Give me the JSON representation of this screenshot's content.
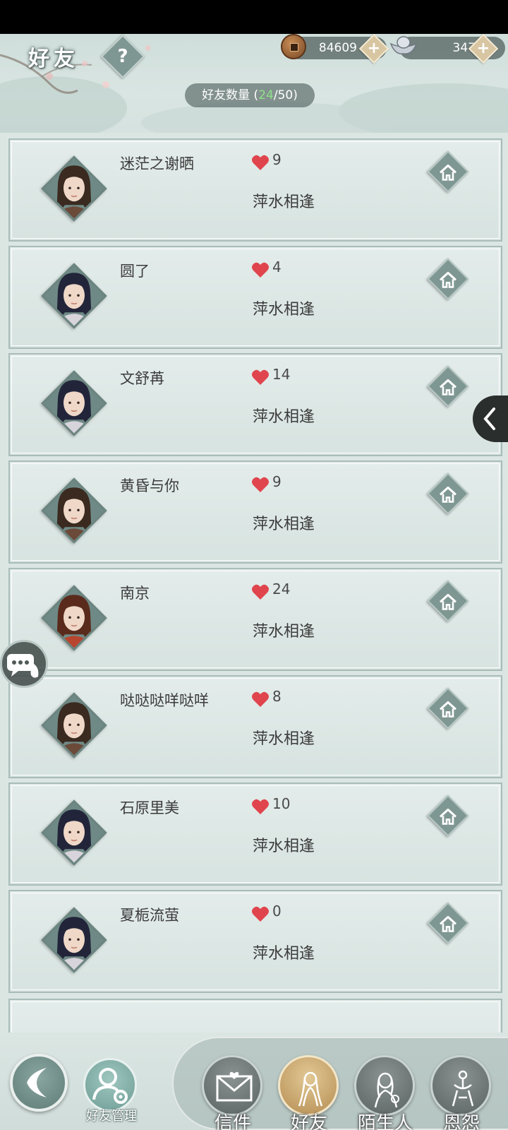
{
  "header": {
    "title": "好友",
    "help_label": "?",
    "copper": "84609",
    "silver": "347",
    "plus_label": "+",
    "friend_count_prefix": "好友数量 (",
    "friend_count_current": "24",
    "friend_count_suffix": "/50)"
  },
  "friends": [
    {
      "name": "迷茫之谢晒",
      "likes": "9",
      "relation": "萍水相逢",
      "hair": "#3a2a20",
      "robe": "#6b4a3a"
    },
    {
      "name": "圆了",
      "likes": "4",
      "relation": "萍水相逢",
      "hair": "#22253a",
      "robe": "#d8d4dc"
    },
    {
      "name": "文舒苒",
      "likes": "14",
      "relation": "萍水相逢",
      "hair": "#22253a",
      "robe": "#d8d4dc"
    },
    {
      "name": "黄昏与你",
      "likes": "9",
      "relation": "萍水相逢",
      "hair": "#3a2a20",
      "robe": "#6b4a3a"
    },
    {
      "name": "南京",
      "likes": "24",
      "relation": "萍水相逢",
      "hair": "#5a2b1c",
      "robe": "#b8452f"
    },
    {
      "name": "哒哒哒咩哒咩",
      "likes": "8",
      "relation": "萍水相逢",
      "hair": "#3a2a20",
      "robe": "#6b4a3a"
    },
    {
      "name": "石原里美",
      "likes": "10",
      "relation": "萍水相逢",
      "hair": "#22253a",
      "robe": "#d8d4dc"
    },
    {
      "name": "夏栀流萤",
      "likes": "0",
      "relation": "萍水相逢",
      "hair": "#22253a",
      "robe": "#d8d4dc"
    }
  ],
  "bottom": {
    "manage_label": "好友管理",
    "tabs": [
      {
        "label": "信件",
        "icon": "letter-icon",
        "active": false
      },
      {
        "label": "好友",
        "icon": "friend-icon",
        "active": true
      },
      {
        "label": "陌生人",
        "icon": "stranger-icon",
        "active": false
      },
      {
        "label": "恩怨",
        "icon": "grudge-icon",
        "active": false
      }
    ]
  },
  "colors": {
    "accent_green": "#8fe08a",
    "heart_red": "#e0454e",
    "panel": "#dbe6e3"
  }
}
